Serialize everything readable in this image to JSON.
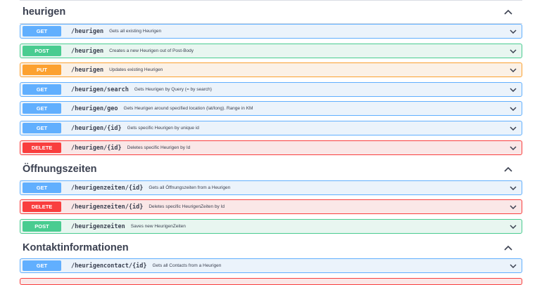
{
  "sections": [
    {
      "title": "heurigen",
      "operations": [
        {
          "method": "GET",
          "path": "/heurigen",
          "summary": "Gets all existing Heurigen"
        },
        {
          "method": "POST",
          "path": "/heurigen",
          "summary": "Creates a new Heurigen out of Post-Body"
        },
        {
          "method": "PUT",
          "path": "/heurigen",
          "summary": "Updates existing Heurigen"
        },
        {
          "method": "GET",
          "path": "/heurigen/search",
          "summary": "Gets Heurigen by Query (= by search)"
        },
        {
          "method": "GET",
          "path": "/heurigen/geo",
          "summary": "Gets Heurigen around specified location (lat/long). Range in KM"
        },
        {
          "method": "GET",
          "path": "/heurigen/{id}",
          "summary": "Gets specific Heurigen by unique id"
        },
        {
          "method": "DELETE",
          "path": "/heurigen/{id}",
          "summary": "Deletes specific Heurigen by Id"
        }
      ]
    },
    {
      "title": "Öffnungszeiten",
      "operations": [
        {
          "method": "GET",
          "path": "/heurigenzeiten/{id}",
          "summary": "Gets all Öffnungszeiten from a Heurigen"
        },
        {
          "method": "DELETE",
          "path": "/heurigenzeiten/{id}",
          "summary": "Deletes specific HeurigenZeiten by Id"
        },
        {
          "method": "POST",
          "path": "/heurigenzeiten",
          "summary": "Saves new HeurigenZeiten"
        }
      ]
    },
    {
      "title": "Kontaktinformationen",
      "operations": [
        {
          "method": "GET",
          "path": "/heurigencontact/{id}",
          "summary": "Gets all Contacts from a Heurigen"
        }
      ]
    }
  ],
  "colors": {
    "get": "#61affe",
    "post": "#49cc90",
    "put": "#fca130",
    "delete": "#f93e3e",
    "text": "#3b4151"
  },
  "icons": {
    "section_toggle": "chevron-up-icon",
    "operation_toggle": "chevron-down-icon"
  }
}
